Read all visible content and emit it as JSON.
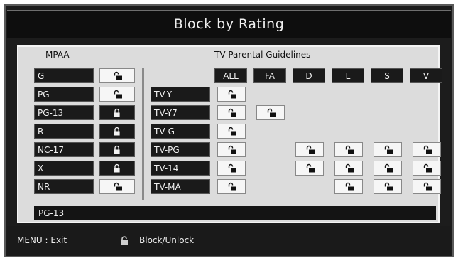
{
  "window": {
    "title": "Block by Rating"
  },
  "mpaa": {
    "label": "MPAA",
    "ratings": [
      {
        "label": "G",
        "locked": false
      },
      {
        "label": "PG",
        "locked": false
      },
      {
        "label": "PG-13",
        "locked": true
      },
      {
        "label": "R",
        "locked": true
      },
      {
        "label": "NC-17",
        "locked": true
      },
      {
        "label": "X",
        "locked": true
      },
      {
        "label": "NR",
        "locked": false
      }
    ]
  },
  "tv": {
    "label": "TV Parental Guidelines",
    "columns": [
      "ALL",
      "FA",
      "D",
      "L",
      "S",
      "V"
    ],
    "rows": [
      {
        "label": "TV-Y",
        "locks": [
          "open",
          null,
          null,
          null,
          null,
          null
        ]
      },
      {
        "label": "TV-Y7",
        "locks": [
          "open",
          "open",
          null,
          null,
          null,
          null
        ]
      },
      {
        "label": "TV-G",
        "locks": [
          "open",
          null,
          null,
          null,
          null,
          null
        ]
      },
      {
        "label": "TV-PG",
        "locks": [
          "open",
          null,
          "open",
          "open",
          "open",
          "open"
        ]
      },
      {
        "label": "TV-14",
        "locks": [
          "open",
          null,
          "open",
          "open",
          "open",
          "open"
        ]
      },
      {
        "label": "TV-MA",
        "locks": [
          "open",
          null,
          null,
          "open",
          "open",
          "open"
        ]
      }
    ]
  },
  "selection": {
    "current": "PG-13"
  },
  "footer": {
    "exit_hint": "MENU : Exit",
    "lock_icon": "lock-icon",
    "lock_hint": "Block/Unlock"
  }
}
